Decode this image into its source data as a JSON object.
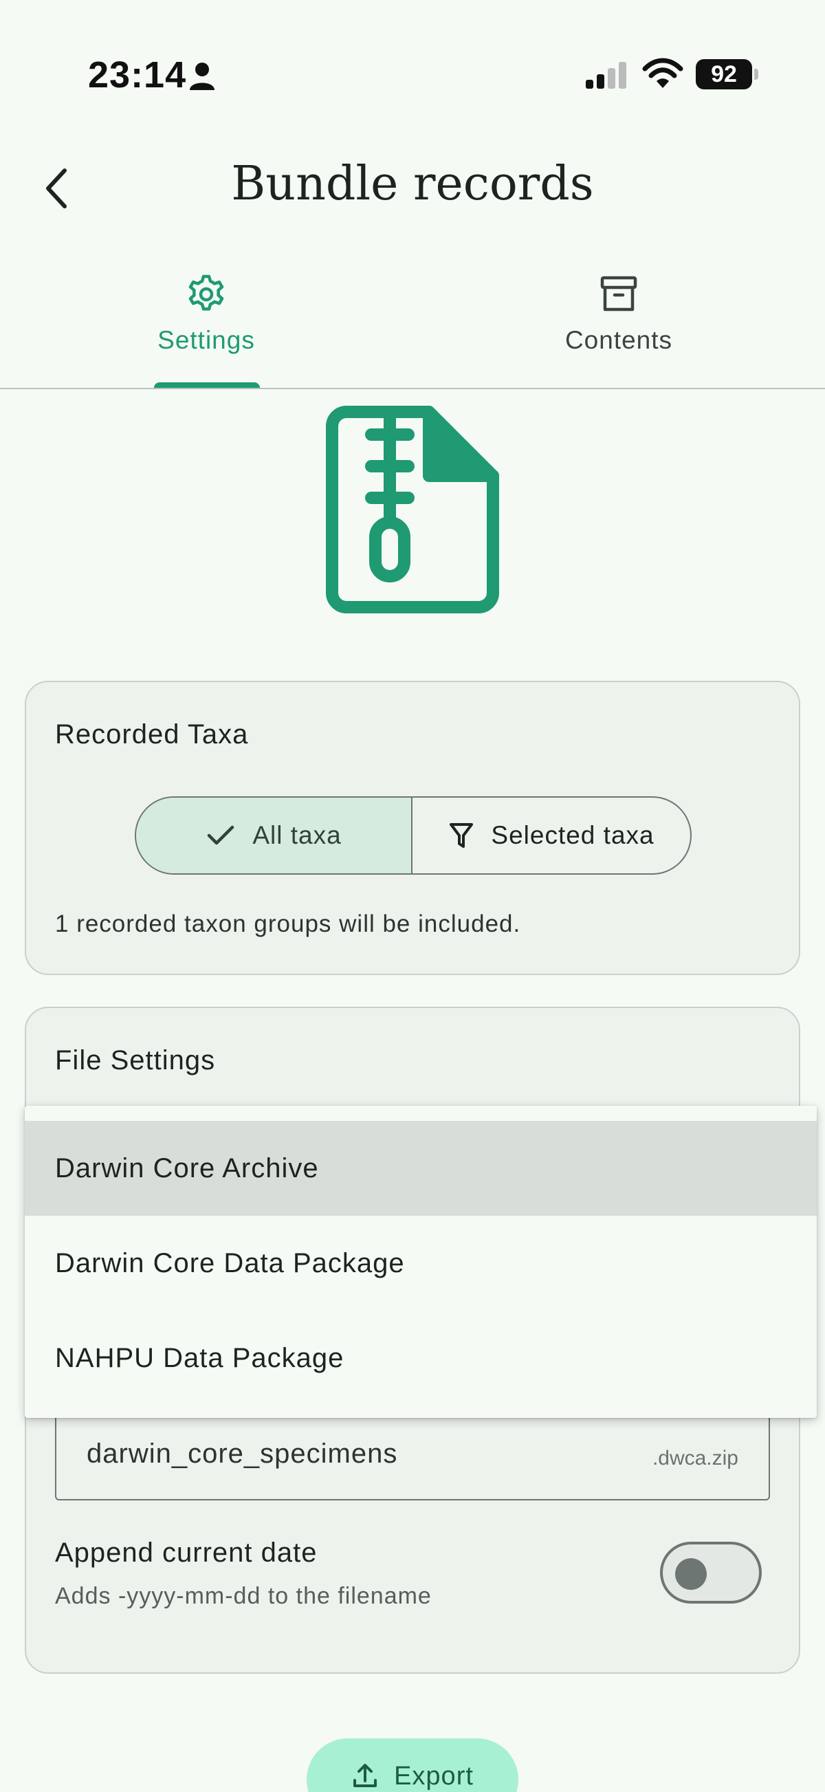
{
  "status_bar": {
    "time": "23:14",
    "battery": "92"
  },
  "header": {
    "title": "Bundle records"
  },
  "tabs": [
    {
      "label": "Settings",
      "icon": "gear-icon",
      "active": true
    },
    {
      "label": "Contents",
      "icon": "archive-box-icon",
      "active": false
    }
  ],
  "colors": {
    "accent": "#1f9a72",
    "background": "#f5faf5",
    "export_button": "#a8f0d2"
  },
  "recorded_taxa": {
    "title": "Recorded Taxa",
    "options": [
      "All taxa",
      "Selected taxa"
    ],
    "selected": "All taxa",
    "note": "1 recorded taxon groups will be included."
  },
  "file_settings": {
    "title": "File Settings",
    "format_options": [
      "Darwin Core Archive",
      "Darwin Core Data Package",
      "NAHPU Data Package"
    ],
    "highlighted_format": "Darwin Core Archive",
    "filename": "darwin_core_specimens",
    "filename_suffix": ".dwca.zip",
    "append_date_label": "Append current date",
    "append_date_description": "Adds -yyyy-mm-dd to the filename",
    "append_date_enabled": false
  },
  "export": {
    "label": "Export"
  }
}
